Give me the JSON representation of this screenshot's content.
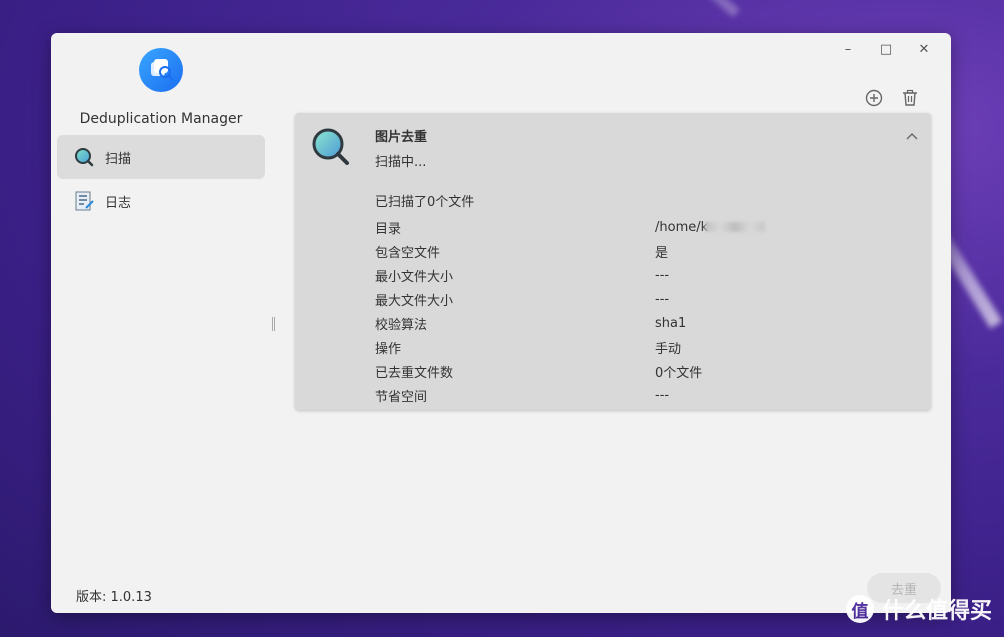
{
  "window": {
    "controls": {
      "minimize": "–",
      "maximize": "□",
      "close": "✕"
    }
  },
  "app": {
    "name": "Deduplication Manager",
    "version_label": "版本: 1.0.13"
  },
  "sidebar": {
    "items": [
      {
        "label": "扫描",
        "icon": "magnifier-icon",
        "active": true
      },
      {
        "label": "日志",
        "icon": "log-document-icon",
        "active": false
      }
    ]
  },
  "toolbar": {
    "add_icon": "plus-circle-icon",
    "delete_icon": "trash-icon"
  },
  "task": {
    "title": "图片去重",
    "status": "扫描中...",
    "scanned_summary": "已扫描了0个文件",
    "details": [
      {
        "key": "目录",
        "value": "/home/k"
      },
      {
        "key": "包含空文件",
        "value": "是"
      },
      {
        "key": "最小文件大小",
        "value": "---"
      },
      {
        "key": "最大文件大小",
        "value": "---"
      },
      {
        "key": "校验算法",
        "value": "sha1"
      },
      {
        "key": "操作",
        "value": "手动"
      },
      {
        "key": "已去重文件数",
        "value": "0个文件"
      },
      {
        "key": "节省空间",
        "value": "---"
      }
    ]
  },
  "dedupe_button": {
    "label": "去重",
    "enabled": false
  },
  "watermark": {
    "symbol": "值",
    "text": "什么值得买"
  },
  "colors": {
    "accent": "#1b6ef0",
    "card_bg": "#d9d9d9",
    "window_bg": "#f2f2f2"
  }
}
